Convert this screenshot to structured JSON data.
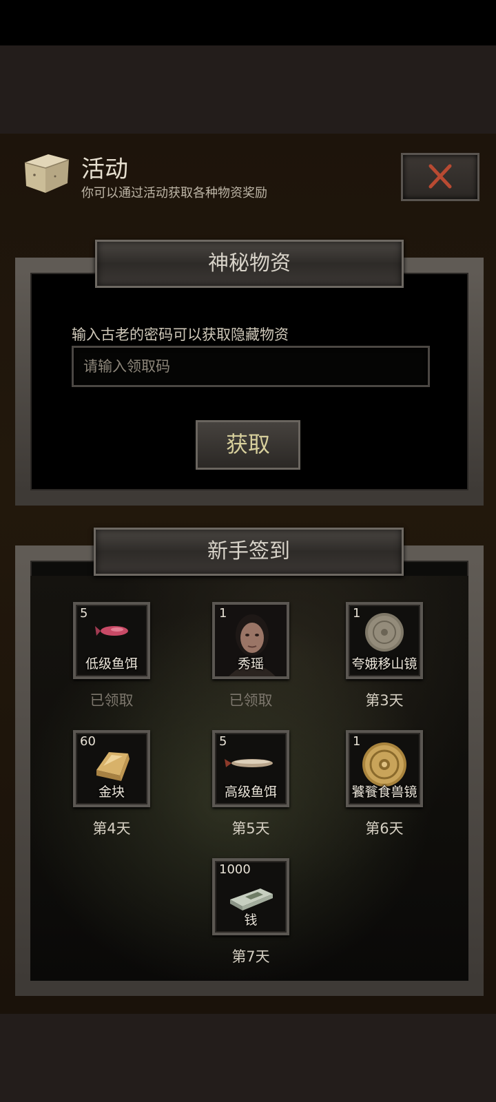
{
  "header": {
    "title": "活动",
    "subtitle": "你可以通过活动获取各种物资奖励"
  },
  "mystery": {
    "title": "神秘物资",
    "hint": "输入古老的密码可以获取隐藏物资",
    "input_placeholder": "请输入领取码",
    "input_value": "",
    "button_label": "获取"
  },
  "signin": {
    "title": "新手签到",
    "items": [
      {
        "count": "5",
        "name": "低级鱼饵",
        "day": "已领取",
        "claimed": true,
        "icon": "lure-red-icon"
      },
      {
        "count": "1",
        "name": "秀瑶",
        "day": "已领取",
        "claimed": true,
        "icon": "character-portrait"
      },
      {
        "count": "1",
        "name": "夸娥移山镜",
        "day": "第3天",
        "claimed": false,
        "icon": "bronze-mirror-icon"
      },
      {
        "count": "60",
        "name": "金块",
        "day": "第4天",
        "claimed": false,
        "icon": "gold-bar-icon"
      },
      {
        "count": "5",
        "name": "高级鱼饵",
        "day": "第5天",
        "claimed": false,
        "icon": "lure-silver-icon"
      },
      {
        "count": "1",
        "name": "饕餮食兽镜",
        "day": "第6天",
        "claimed": false,
        "icon": "golden-mirror-icon"
      },
      {
        "count": "1000",
        "name": "钱",
        "day": "第7天",
        "claimed": false,
        "icon": "cash-stack-icon"
      }
    ]
  },
  "colors": {
    "close_x": "#b84a32",
    "button_text": "#d7cf9c",
    "claimed_text": "#7d776d"
  }
}
